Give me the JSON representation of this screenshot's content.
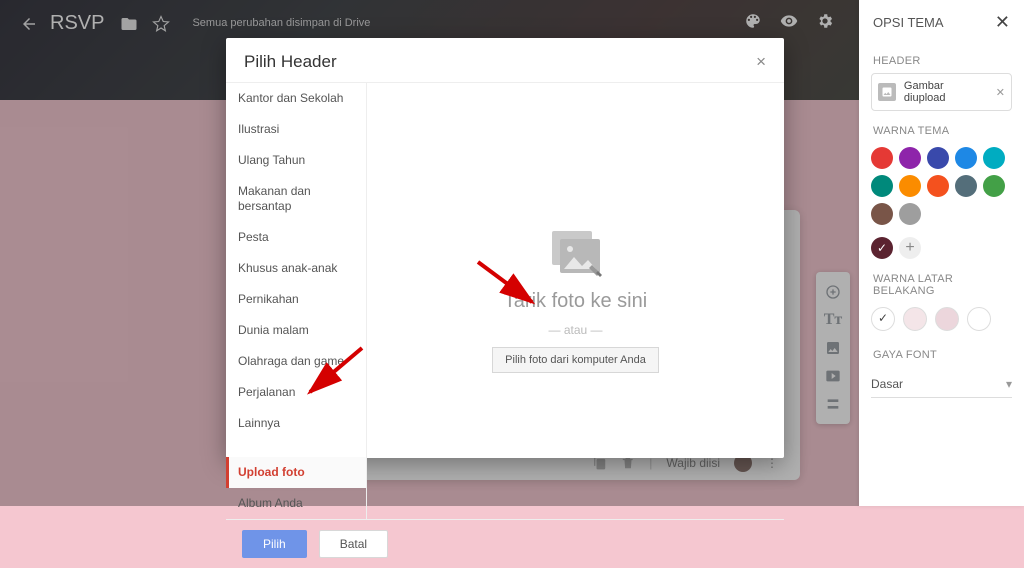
{
  "topbar": {
    "title": "RSVP",
    "subtitle": "Semua perubahan disimpan di Drive"
  },
  "modal": {
    "title": "Pilih Header",
    "categories": [
      "Kantor dan Sekolah",
      "Ilustrasi",
      "Ulang Tahun",
      "Makanan dan bersantap",
      "Pesta",
      "Khusus anak-anak",
      "Pernikahan",
      "Dunia malam",
      "Olahraga dan game",
      "Perjalanan",
      "Lainnya"
    ],
    "active_category": "Upload foto",
    "extra_category": "Album Anda",
    "drop_hint": "Tarik foto ke sini",
    "or": "— atau —",
    "pick_button": "Pilih foto dari komputer Anda",
    "btn_select": "Pilih",
    "btn_cancel": "Batal"
  },
  "right_panel": {
    "title": "OPSI TEMA",
    "header_section": "HEADER",
    "header_chip": "Gambar diupload",
    "theme_color_section": "WARNA TEMA",
    "theme_colors": [
      "#e53935",
      "#8e24aa",
      "#3949ab",
      "#1e88e5",
      "#00acc1",
      "#00897b",
      "#fb8c00",
      "#f4511e",
      "#546e7a",
      "#43a047",
      "#795548",
      "#9e9e9e"
    ],
    "selected_color": "#5b2330",
    "bg_section": "WARNA LATAR BELAKANG",
    "bg_colors": [
      "#ffffff",
      "#f4e5e8",
      "#ecd6dc",
      "#ffffff"
    ],
    "font_section": "GAYA FONT",
    "font_value": "Dasar"
  },
  "card": {
    "required": "Wajib diisi"
  }
}
